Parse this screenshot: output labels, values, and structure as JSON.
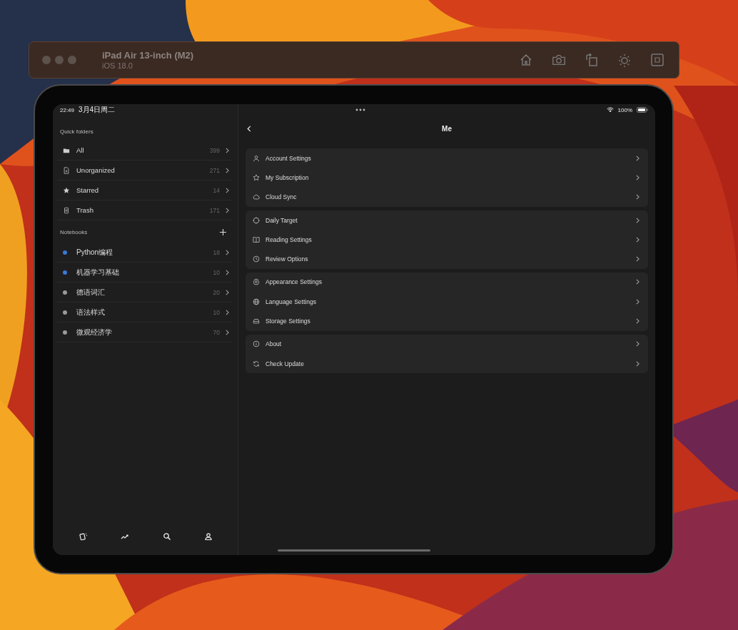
{
  "simulator": {
    "device": "iPad Air 13-inch (M2)",
    "os": "iOS 18.0"
  },
  "status_bar": {
    "time": "22:49",
    "date": "3月4日周二",
    "battery": "100%"
  },
  "sidebar": {
    "quick_folders_title": "Quick folders",
    "quick_folders": [
      {
        "kind": "folder",
        "label": "All",
        "count": "399"
      },
      {
        "kind": "document",
        "label": "Unorganized",
        "count": "271"
      },
      {
        "kind": "star",
        "label": "Starred",
        "count": "14"
      },
      {
        "kind": "trash",
        "label": "Trash",
        "count": "171"
      }
    ],
    "notebooks_title": "Notebooks",
    "notebooks": [
      {
        "label": "Python编程",
        "count": "18",
        "color": "#3a78d8"
      },
      {
        "label": "机器学习基础",
        "count": "10",
        "color": "#3a78d8"
      },
      {
        "label": "德语词汇",
        "count": "20",
        "color": "#9a9a9a"
      },
      {
        "label": "语法样式",
        "count": "10",
        "color": "#9a9a9a"
      },
      {
        "label": "微观经济学",
        "count": "70",
        "color": "#9a9a9a"
      }
    ]
  },
  "detail": {
    "title": "Me",
    "groups": [
      [
        {
          "kind": "person",
          "label": "Account Settings"
        },
        {
          "kind": "star",
          "label": "My Subscription"
        },
        {
          "kind": "cloud",
          "label": "Cloud Sync"
        }
      ],
      [
        {
          "kind": "target",
          "label": "Daily Target"
        },
        {
          "kind": "book",
          "label": "Reading Settings"
        },
        {
          "kind": "clock",
          "label": "Review Options"
        }
      ],
      [
        {
          "kind": "gear",
          "label": "Appearance Settings"
        },
        {
          "kind": "globe",
          "label": "Language Settings"
        },
        {
          "kind": "drive",
          "label": "Storage Settings"
        }
      ],
      [
        {
          "kind": "info",
          "label": "About"
        },
        {
          "kind": "refresh",
          "label": "Check Update"
        }
      ]
    ]
  }
}
